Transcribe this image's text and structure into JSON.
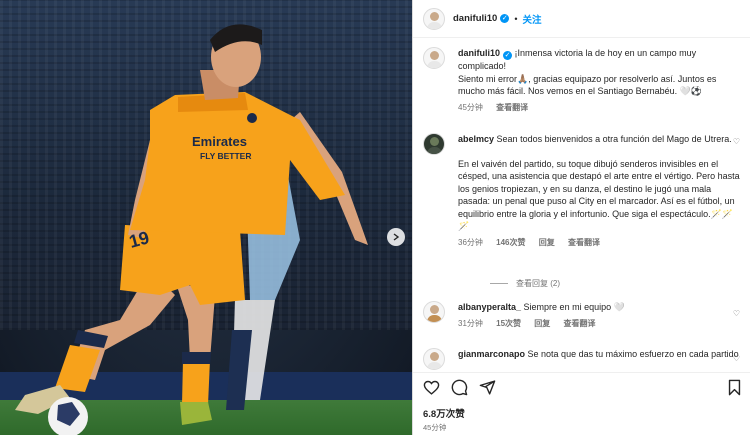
{
  "post": {
    "username": "danifuli10",
    "follow_label": "关注",
    "separator": "•",
    "caption_line1": "¡Inmensa victoria la de hoy en un campo muy complicado!",
    "caption_line2": "Siento mi error🙏🏽, gracias equipazo por resolverlo así. Juntos es mucho más fácil. Nos vemos en el Santiago Bernabéu. 🤍⚽",
    "caption_time": "45分钟",
    "caption_translate": "查看翻译",
    "likes": "6.8万次赞",
    "posted_ago": "45分钟",
    "photo_jersey_text": "Emirates FLY BETTER",
    "photo_number": "19"
  },
  "comments": [
    {
      "username": "abelmcy",
      "text_1": "Sean todos bienvenidos a otra función del Mago de Utrera.",
      "text_2": "En el vaivén del partido, su toque dibujó senderos invisibles en el césped, una asistencia que destapó el arte entre el vértigo. Pero hasta los genios tropiezan, y en su danza, el destino le jugó una mala pasada: un penal que puso al City en el marcador. Así es el fútbol, un equilibrio entre la gloria y el infortunio. Que siga el espectáculo.🪄🪄🪄",
      "time": "36分钟",
      "likes": "146次赞",
      "reply": "回复",
      "translate": "查看翻译",
      "view_replies": "查看回复 (2)"
    },
    {
      "username": "albanyperalta_",
      "text": "Siempre en mi equipo 🤍",
      "time": "31分钟",
      "likes": "15次赞",
      "reply": "回复",
      "translate": "查看翻译"
    },
    {
      "username": "gianmarconapo",
      "text": "Se nota que das tu máximo esfuerzo en cada partido"
    }
  ],
  "icons": {
    "heart": "heart-icon",
    "comment": "comment-icon",
    "share": "share-icon",
    "save": "bookmark-icon",
    "verified": "verified-badge-icon",
    "next": "chevron-right-icon"
  },
  "colors": {
    "accent": "#0095f6",
    "muted": "#737373",
    "jersey": "#f7a21b"
  }
}
